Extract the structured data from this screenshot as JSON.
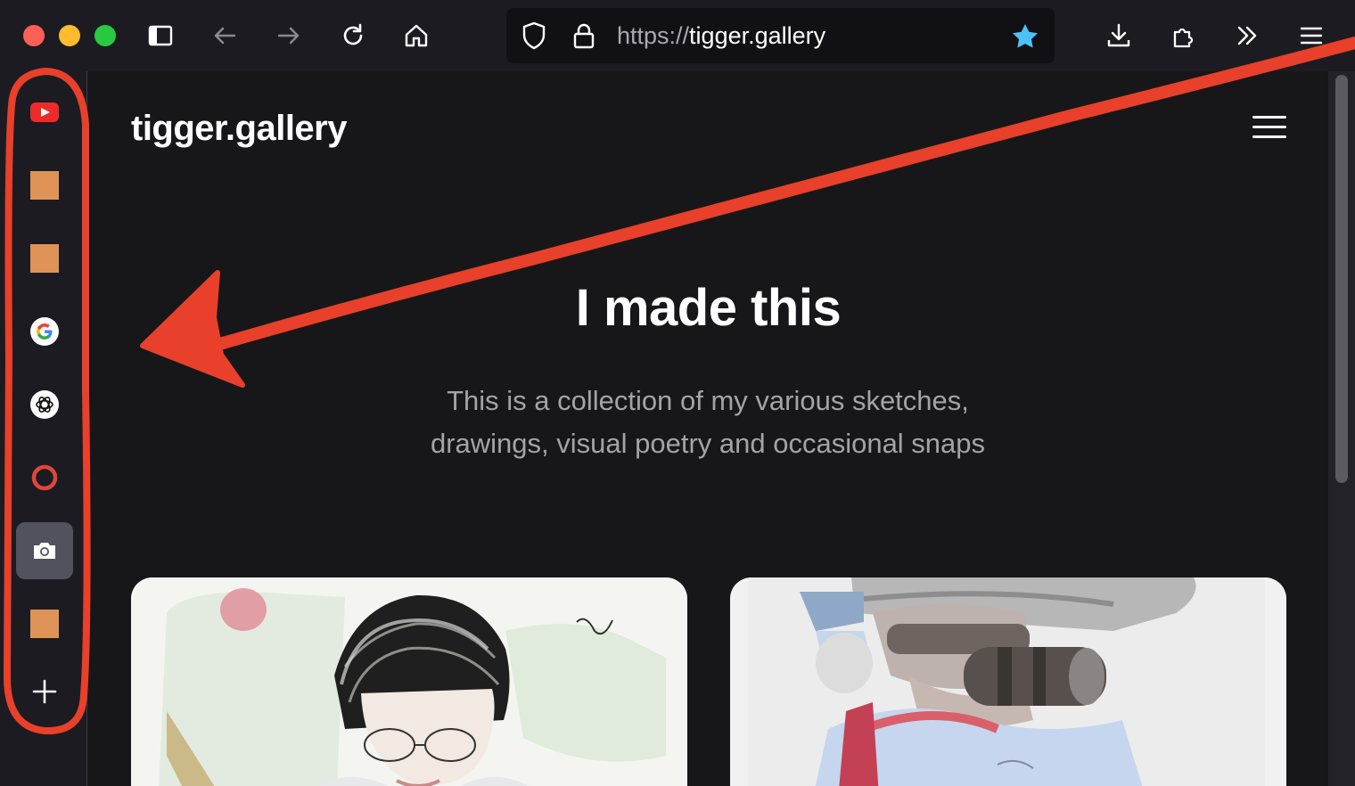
{
  "browser": {
    "url_scheme": "https://",
    "url_host": "tigger.gallery",
    "toolbar_icons": [
      "sidebar-toggle-icon",
      "back-arrow-icon",
      "forward-arrow-icon",
      "reload-icon",
      "home-icon",
      "download-icon",
      "extensions-icon",
      "more-tools-icon",
      "app-menu-icon"
    ],
    "bookmark_star_color": "#4cc1f5"
  },
  "sidebar": {
    "items": [
      {
        "name": "youtube",
        "icon": "youtube-icon"
      },
      {
        "name": "orange-tile-1",
        "icon": "orange-square-icon"
      },
      {
        "name": "orange-tile-2",
        "icon": "orange-square-icon"
      },
      {
        "name": "google",
        "icon": "google-icon"
      },
      {
        "name": "chatgpt",
        "icon": "openai-icon"
      },
      {
        "name": "opera",
        "icon": "ring-icon"
      },
      {
        "name": "screenshot",
        "icon": "camera-icon",
        "active": true
      },
      {
        "name": "orange-tile-3",
        "icon": "orange-square-icon"
      },
      {
        "name": "add-panel",
        "icon": "plus-icon"
      }
    ],
    "accent_color": "#df9356"
  },
  "page": {
    "site_title": "tigger.gallery",
    "hero_title": "I made this",
    "hero_subtitle_line1": "This is a collection of my various sketches,",
    "hero_subtitle_line2": "drawings, visual poetry and occasional snaps"
  },
  "annotation": {
    "color": "#e8402a"
  }
}
